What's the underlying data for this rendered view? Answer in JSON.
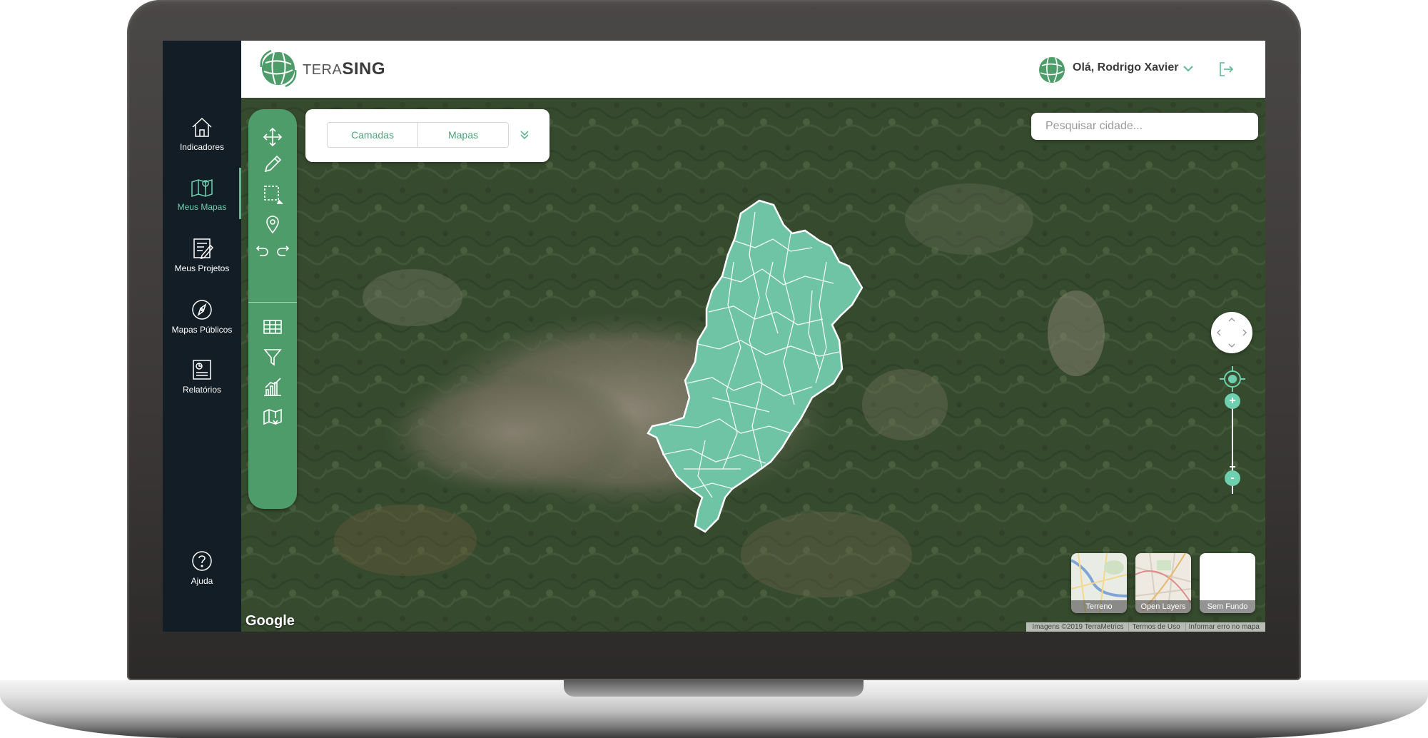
{
  "app": {
    "logo_prefix": "TERA",
    "logo_suffix": "SING",
    "greeting": "Olá, Rodrigo Xavier",
    "accent_color": "#5fb892",
    "nav_color": "#131d26",
    "tool_panel_color": "#4f9c6b",
    "map_region_color": "#6fc4a6"
  },
  "nav": {
    "items": [
      {
        "label": "Indicadores",
        "icon": "home-icon",
        "active": false
      },
      {
        "label": "Meus Mapas",
        "icon": "map-pin-icon",
        "active": true
      },
      {
        "label": "Meus Projetos",
        "icon": "project-edit-icon",
        "active": false
      },
      {
        "label": "Mapas Públicos",
        "icon": "compass-icon",
        "active": false
      },
      {
        "label": "Relatórios",
        "icon": "report-icon",
        "active": false
      }
    ],
    "help_label": "Ajuda"
  },
  "tools": [
    "move-icon",
    "pencil-icon",
    "select-rectangle-icon",
    "location-pin-icon",
    "undo-icon",
    "redo-icon",
    "table-icon",
    "filter-icon",
    "bar-chart-icon",
    "map-download-icon"
  ],
  "tabs": {
    "layers": "Camadas",
    "maps": "Mapas"
  },
  "search": {
    "placeholder": "Pesquisar cidade..."
  },
  "basemaps": [
    {
      "label": "Terreno"
    },
    {
      "label": "Open Layers"
    },
    {
      "label": "Sem Fundo"
    }
  ],
  "zoom": {
    "in": "+",
    "out": "-"
  },
  "attribution": {
    "brand": "Google",
    "imagery": "Imagens ©2019 TerraMetrics",
    "terms": "Termos de Uso",
    "report": "Informar erro no mapa"
  }
}
